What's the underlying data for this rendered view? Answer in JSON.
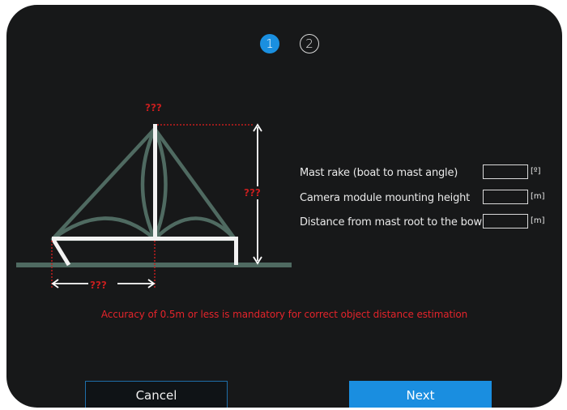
{
  "wizard": {
    "steps": [
      {
        "number": "1",
        "active": true
      },
      {
        "number": "2",
        "active": false
      }
    ]
  },
  "diagram": {
    "unknown_marker": "???"
  },
  "fields": [
    {
      "label": "Mast rake (boat to mast angle)",
      "value": "",
      "unit": "[º]"
    },
    {
      "label": "Camera module mounting height",
      "value": "",
      "unit": "[m]"
    },
    {
      "label": "Distance from mast root to the bow",
      "value": "",
      "unit": "[m]"
    }
  ],
  "warning": "Accuracy of 0.5m or less is mandatory for correct object distance estimation",
  "buttons": {
    "cancel": "Cancel",
    "next": "Next"
  },
  "colors": {
    "accent": "#1a8ee0",
    "warning": "#e4242b",
    "boat_stroke": "#4f6a61",
    "marker": "#c41e1e"
  }
}
